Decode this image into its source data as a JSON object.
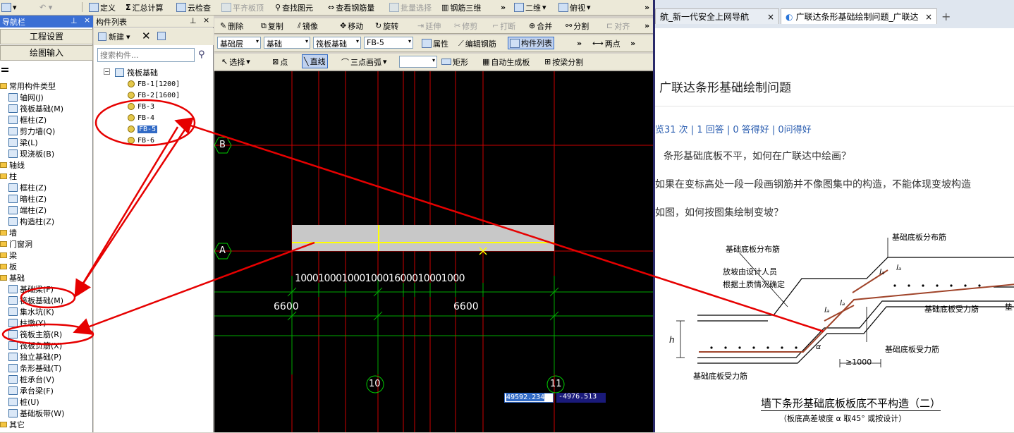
{
  "menu": {
    "items": [
      "定义",
      "汇总计算",
      "云检查",
      "平齐板顶",
      "查找图元",
      "查看钢筋量",
      "批量选择",
      "钢筋三维"
    ],
    "view_2d": "二维",
    "view_top": "俯视",
    "overflow": "»"
  },
  "nav": {
    "title": "导航栏",
    "pin": "ᵩ",
    "close": "×",
    "project_settings": "工程设置",
    "drawing_input": "绘图输入",
    "items": [
      {
        "label": "常用构件类型",
        "kind": "folder"
      },
      {
        "label": "轴网(J)",
        "kind": "item"
      },
      {
        "label": "筏板基础(M)",
        "kind": "item"
      },
      {
        "label": "框柱(Z)",
        "kind": "item"
      },
      {
        "label": "剪力墙(Q)",
        "kind": "item"
      },
      {
        "label": "梁(L)",
        "kind": "item"
      },
      {
        "label": "现浇板(B)",
        "kind": "item"
      },
      {
        "label": "轴线",
        "kind": "folder"
      },
      {
        "label": "柱",
        "kind": "folder"
      },
      {
        "label": "框柱(Z)",
        "kind": "item"
      },
      {
        "label": "暗柱(Z)",
        "kind": "item"
      },
      {
        "label": "端柱(Z)",
        "kind": "item"
      },
      {
        "label": "构造柱(Z)",
        "kind": "item"
      },
      {
        "label": "墙",
        "kind": "folder"
      },
      {
        "label": "门窗洞",
        "kind": "folder"
      },
      {
        "label": "梁",
        "kind": "folder"
      },
      {
        "label": "板",
        "kind": "folder"
      },
      {
        "label": "基础",
        "kind": "folder"
      },
      {
        "label": "基础梁(F)",
        "kind": "item"
      },
      {
        "label": "筏板基础(M)",
        "kind": "item"
      },
      {
        "label": "集水坑(K)",
        "kind": "item"
      },
      {
        "label": "柱墩(Y)",
        "kind": "item"
      },
      {
        "label": "筏板主筋(R)",
        "kind": "item"
      },
      {
        "label": "筏板负筋(X)",
        "kind": "item"
      },
      {
        "label": "独立基础(P)",
        "kind": "item"
      },
      {
        "label": "条形基础(T)",
        "kind": "item"
      },
      {
        "label": "桩承台(V)",
        "kind": "item"
      },
      {
        "label": "承台梁(F)",
        "kind": "item"
      },
      {
        "label": "桩(U)",
        "kind": "item"
      },
      {
        "label": "基础板带(W)",
        "kind": "item"
      },
      {
        "label": "其它",
        "kind": "folder"
      }
    ]
  },
  "components": {
    "title": "构件列表",
    "new_label": "新建",
    "search_placeholder": "搜索构件...",
    "root": "筏板基础",
    "items": [
      "FB-1[1200]",
      "FB-2[1600]",
      "FB-3",
      "FB-4",
      "FB-5",
      "FB-6"
    ],
    "selected": "FB-5"
  },
  "edit_toolbar": {
    "items": [
      "删除",
      "复制",
      "镜像",
      "移动",
      "旋转",
      "延伸",
      "修剪",
      "打断",
      "合并",
      "分割",
      "对齐"
    ]
  },
  "layer_bar": {
    "layer_type": "基础层",
    "layer": "基础",
    "category": "筏板基础",
    "component": "FB-5",
    "properties": "属性",
    "edit_rebar": "编辑钢筋",
    "component_list": "构件列表",
    "two_points": "两点"
  },
  "draw_bar": {
    "select": "选择",
    "point": "点",
    "line": "直线",
    "arc": "三点画弧",
    "rect": "矩形",
    "auto_gen": "自动生成板",
    "split_by_beam": "按梁分割"
  },
  "canvas": {
    "axis_b": "B",
    "axis_a": "A",
    "axis_10": "10",
    "axis_11": "11",
    "dims_top": "10001000100010001600010001000",
    "dim_left": "6600",
    "dim_right": "6600",
    "coord_x": "49592.234",
    "coord_y": "-4976.513"
  },
  "browser": {
    "tab1": "航_新一代安全上网导航",
    "tab2": "广联达条形基础绘制问题_广联达",
    "question_title": "广联达条形基础绘制问题",
    "stats": "览31 次 | 1 回答 | 0 答得好 | 0问得好",
    "line1": "条形基础底板不平，如何在广联达中绘画？",
    "line2": "如果在变标高处一段一段画钢筋并不像图集中的构造，不能体现变坡构造",
    "line3": "如图，如何按图集绘制变坡？",
    "drawing": {
      "lbl_dist_left": "基础底板分布筋",
      "lbl_dist_right": "基础底板分布筋",
      "lbl_note1": "放坡由设计人员",
      "lbl_note2": "根据土质情况确定",
      "lbl_force_right": "基础底板受力筋",
      "lbl_force_mid": "基础底板受力筋",
      "lbl_force_left": "基础底板受力筋",
      "lbl_h": "h",
      "lbl_1000": "≥1000",
      "lbl_la1": "lₐ",
      "lbl_la2": "lₐ",
      "lbl_la3": "lₐ",
      "lbl_la4": "lₐ",
      "lbl_alpha": "α",
      "lbl_cut": "垫",
      "caption": "墙下条形基础底板板底不平构造（二）",
      "sub_caption": "（板底高差坡度 α 取45° 或按设计）"
    }
  }
}
